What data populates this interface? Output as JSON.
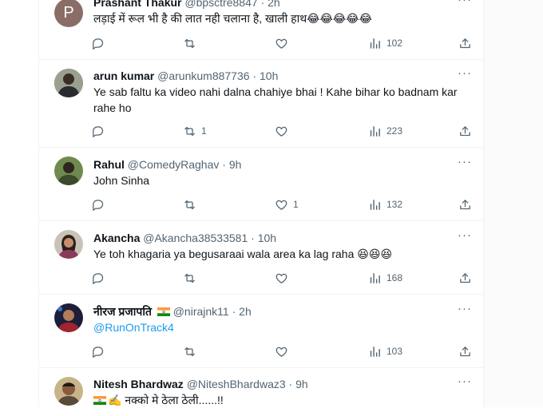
{
  "replies": [
    {
      "name": "Prashant Thakur",
      "handle": "@bpsctre8847",
      "time": "2h",
      "avatar_letter": "P",
      "text": "लड़ाई में रूल भी है की लात नही चलाना है, खाली हाथ😂😂😂😂😂",
      "counts": {
        "replies": "",
        "reposts": "",
        "likes": "",
        "views": "102"
      }
    },
    {
      "name": "arun kumar",
      "handle": "@arunkum887736",
      "time": "10h",
      "text": "Ye sab faltu ka video nahi dalna chahiye bhai ! Kahe bihar ko badnam kar rahe ho",
      "counts": {
        "replies": "",
        "reposts": "1",
        "likes": "",
        "views": "223"
      }
    },
    {
      "name": "Rahul",
      "handle": "@ComedyRaghav",
      "time": "9h",
      "text": "John Sinha",
      "counts": {
        "replies": "",
        "reposts": "",
        "likes": "1",
        "views": "132"
      }
    },
    {
      "name": "Akancha",
      "handle": "@Akancha38533581",
      "time": "10h",
      "text": "Ye toh khagaria ya begusaraai wala area ka lag raha 😆😆😆",
      "counts": {
        "replies": "",
        "reposts": "",
        "likes": "",
        "views": "168"
      }
    },
    {
      "name": "नीरज प्रजापति",
      "handle": "@nirajnk11",
      "time": "2h",
      "text": "@RunOnTrack4",
      "counts": {
        "replies": "",
        "reposts": "",
        "likes": "",
        "views": "103"
      }
    },
    {
      "name": "Nitesh Bhardwaz",
      "handle": "@NiteshBhardwaz3",
      "time": "9h",
      "text": "✍️ नक्को मे ठेला ठेली......!!"
    }
  ],
  "separator": " · ",
  "more_label": "···",
  "colors": {
    "link": "#1d9bf0",
    "muted": "#536471",
    "border": "#eff3f4"
  }
}
